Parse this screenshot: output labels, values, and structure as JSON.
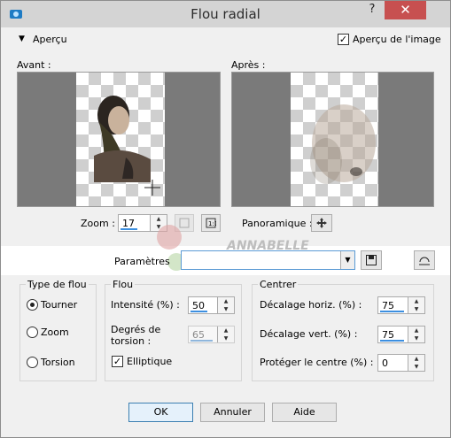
{
  "window": {
    "title": "Flou radial",
    "help_label": "?",
    "close_label": "✕",
    "icon": "app-icon"
  },
  "preview_header": {
    "label": "Aperçu",
    "checkbox_label": "Aperçu de l'image",
    "checked": true
  },
  "before": {
    "label": "Avant :"
  },
  "after": {
    "label": "Après :"
  },
  "zoom": {
    "label": "Zoom :",
    "value": "17",
    "progress": 0.5
  },
  "pan": {
    "label": "Panoramique :"
  },
  "params": {
    "label": "Paramètres",
    "value": ""
  },
  "watermark": "ANNABELLE",
  "blur_type": {
    "title": "Type de flou",
    "options": [
      "Tourner",
      "Zoom",
      "Torsion"
    ],
    "selected": "Tourner"
  },
  "blur": {
    "title": "Flou",
    "intensity_label": "Intensité (%) :",
    "intensity": "50",
    "intensity_progress": 0.5,
    "twist_label_1": "Degrés de",
    "twist_label_2": "torsion :",
    "twist": "65",
    "twist_progress": 0.7,
    "elliptic_label": "Elliptique",
    "elliptic": true
  },
  "center": {
    "title": "Centrer",
    "hshift_label": "Décalage horiz. (%) :",
    "hshift": "75",
    "hshift_progress": 0.75,
    "vshift_label": "Décalage vert. (%) :",
    "vshift": "75",
    "vshift_progress": 0.75,
    "protect_label": "Protéger le centre (%) :",
    "protect": "0"
  },
  "buttons": {
    "ok": "OK",
    "cancel": "Annuler",
    "help": "Aide"
  },
  "colors": {
    "accent": "#3c8fe0",
    "close": "#c75050",
    "panel": "#7a7a7a"
  }
}
